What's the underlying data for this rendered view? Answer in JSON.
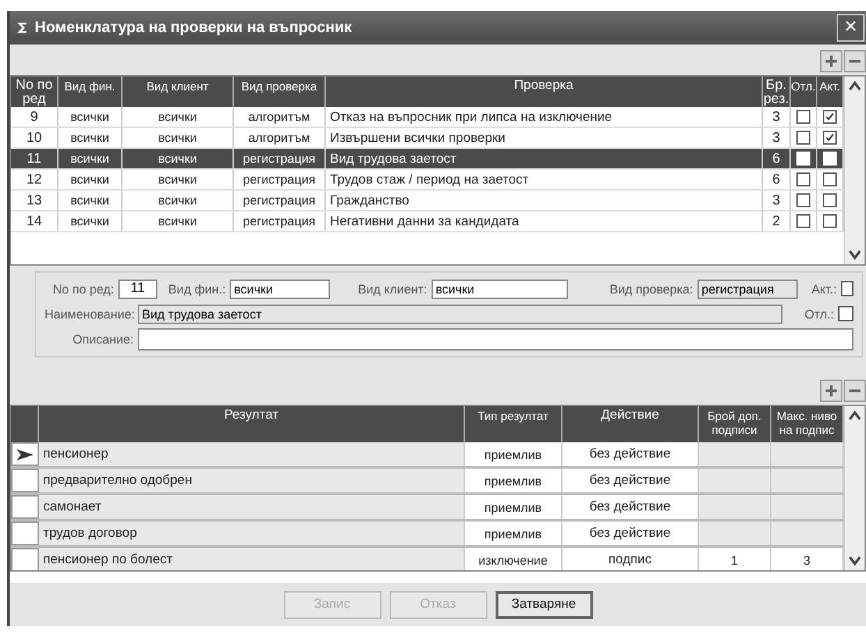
{
  "window": {
    "title": "Номенклатура на проверки на въпросник",
    "close": "×"
  },
  "checks_table": {
    "columns": [
      "No по ред",
      "Вид фин.",
      "Вид клиент",
      "Вид проверка",
      "Проверка",
      "Бр. рез.",
      "Отл.",
      "Акт."
    ],
    "rows": [
      {
        "no": "9",
        "fin": "всички",
        "client": "всички",
        "type": "алгоритъм",
        "name": "Отказ на въпросник при липса на изключение",
        "results": "3",
        "rejected": false,
        "active": true,
        "selected": false
      },
      {
        "no": "10",
        "fin": "всички",
        "client": "всички",
        "type": "алгоритъм",
        "name": "Извършени всички проверки",
        "results": "3",
        "rejected": false,
        "active": true,
        "selected": false
      },
      {
        "no": "11",
        "fin": "всички",
        "client": "всички",
        "type": "регистрация",
        "name": "Вид трудова заетост",
        "results": "6",
        "rejected": false,
        "active": false,
        "selected": true
      },
      {
        "no": "12",
        "fin": "всички",
        "client": "всички",
        "type": "регистрация",
        "name": "Трудов стаж / период на заетост",
        "results": "6",
        "rejected": false,
        "active": false,
        "selected": false
      },
      {
        "no": "13",
        "fin": "всички",
        "client": "всички",
        "type": "регистрация",
        "name": "Гражданство",
        "results": "3",
        "rejected": false,
        "active": false,
        "selected": false
      },
      {
        "no": "14",
        "fin": "всички",
        "client": "всички",
        "type": "регистрация",
        "name": "Негативни данни за кандидата",
        "results": "2",
        "rejected": false,
        "active": false,
        "selected": false
      }
    ]
  },
  "form": {
    "no_label": "No по ред:",
    "no_value": "11",
    "fin_label": "Вид фин.:",
    "fin_value": "всички",
    "client_label": "Вид клиент:",
    "client_value": "всички",
    "type_label": "Вид проверка:",
    "type_value": "регистрация",
    "active_label": "Акт.:",
    "active": false,
    "name_label": "Наименование:",
    "name_value": "Вид трудова заетост",
    "rejected_label": "Отл.:",
    "rejected": false,
    "description_label": "Описание:"
  },
  "results_table": {
    "columns": [
      "Резултат",
      "Тип резултат",
      "Действие",
      "Брой доп. подписи",
      "Макс. ниво на подпис"
    ],
    "rows": [
      {
        "result": "пенсионер",
        "type": "приемлив",
        "action": "без действие",
        "signatures": "",
        "max_level": "",
        "current": true
      },
      {
        "result": "предварително одобрен",
        "type": "приемлив",
        "action": "без действие",
        "signatures": "",
        "max_level": "",
        "current": false
      },
      {
        "result": "самонает",
        "type": "приемлив",
        "action": "без действие",
        "signatures": "",
        "max_level": "",
        "current": false
      },
      {
        "result": "трудов договор",
        "type": "приемлив",
        "action": "без действие",
        "signatures": "",
        "max_level": "",
        "current": false
      },
      {
        "result": "пенсионер по болест",
        "type": "изключение",
        "action": "подпис",
        "signatures": "1",
        "max_level": "3",
        "current": false
      }
    ]
  },
  "buttons": [
    {
      "label": "Запис",
      "disabled": true
    },
    {
      "label": "Отказ",
      "disabled": true
    },
    {
      "label": "Затваряне",
      "disabled": false
    }
  ]
}
